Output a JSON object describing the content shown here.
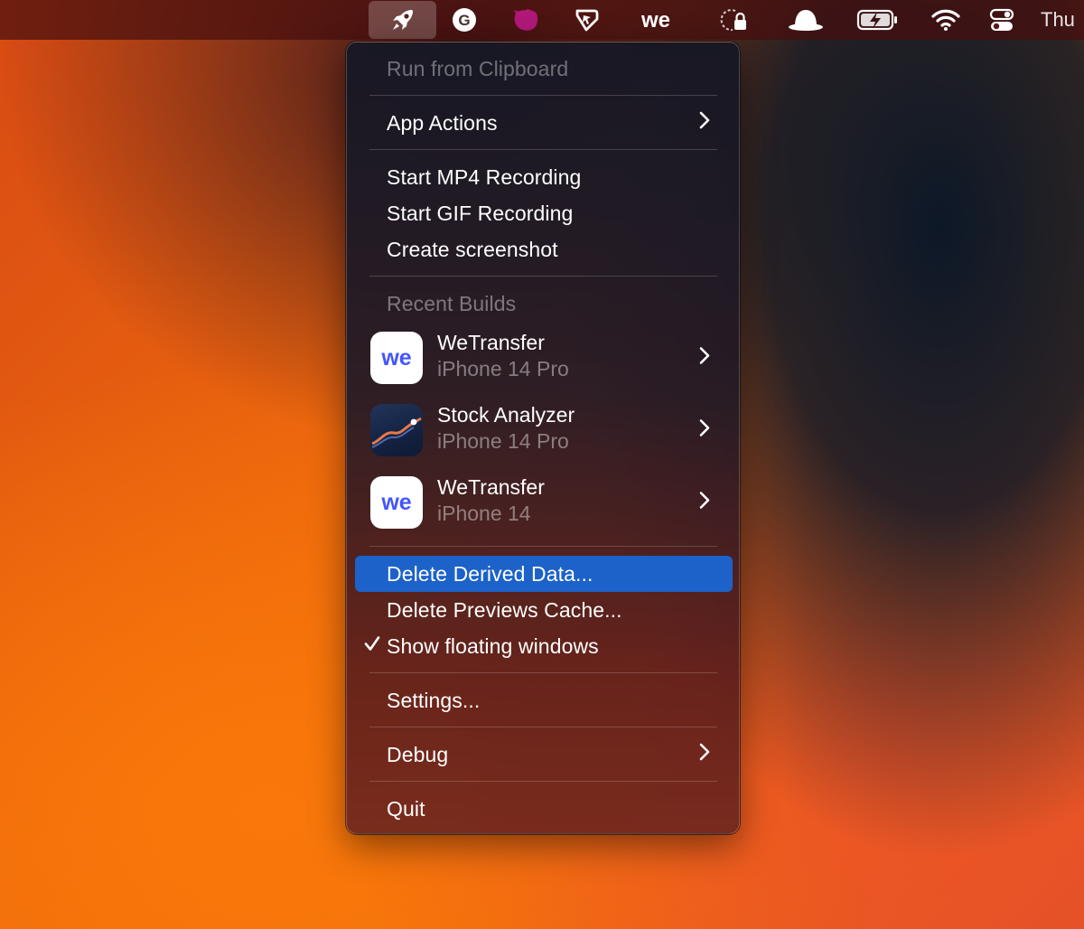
{
  "menubar": {
    "icons": [
      {
        "name": "rocket-icon",
        "active": true
      },
      {
        "name": "grammarly-icon"
      },
      {
        "name": "purple-blob-icon",
        "color": "#b0187a"
      },
      {
        "name": "cursor-pointer-icon"
      },
      {
        "name": "wetransfer-icon"
      },
      {
        "name": "lock-icon"
      },
      {
        "name": "bowler-hat-icon"
      },
      {
        "name": "battery-charging-icon"
      },
      {
        "name": "wifi-icon"
      },
      {
        "name": "control-center-icon"
      }
    ],
    "clock": "Thu"
  },
  "menu": {
    "run_from_clipboard": "Run from Clipboard",
    "app_actions": "App Actions",
    "start_mp4": "Start MP4 Recording",
    "start_gif": "Start GIF Recording",
    "create_screenshot": "Create screenshot",
    "recent_builds_header": "Recent Builds",
    "recent_builds": [
      {
        "name": "WeTransfer",
        "device": "iPhone 14 Pro",
        "icon": "wetransfer-app-icon"
      },
      {
        "name": "Stock Analyzer",
        "device": "iPhone 14 Pro",
        "icon": "stock-analyzer-app-icon"
      },
      {
        "name": "WeTransfer",
        "device": "iPhone 14",
        "icon": "wetransfer-app-icon"
      }
    ],
    "delete_derived": "Delete Derived Data...",
    "delete_previews": "Delete Previews Cache...",
    "show_floating": "Show floating windows",
    "show_floating_checked": true,
    "settings": "Settings...",
    "debug": "Debug",
    "quit": "Quit"
  },
  "colors": {
    "highlight": "#1c62c9",
    "wetransfer_blue": "#4255ff"
  }
}
